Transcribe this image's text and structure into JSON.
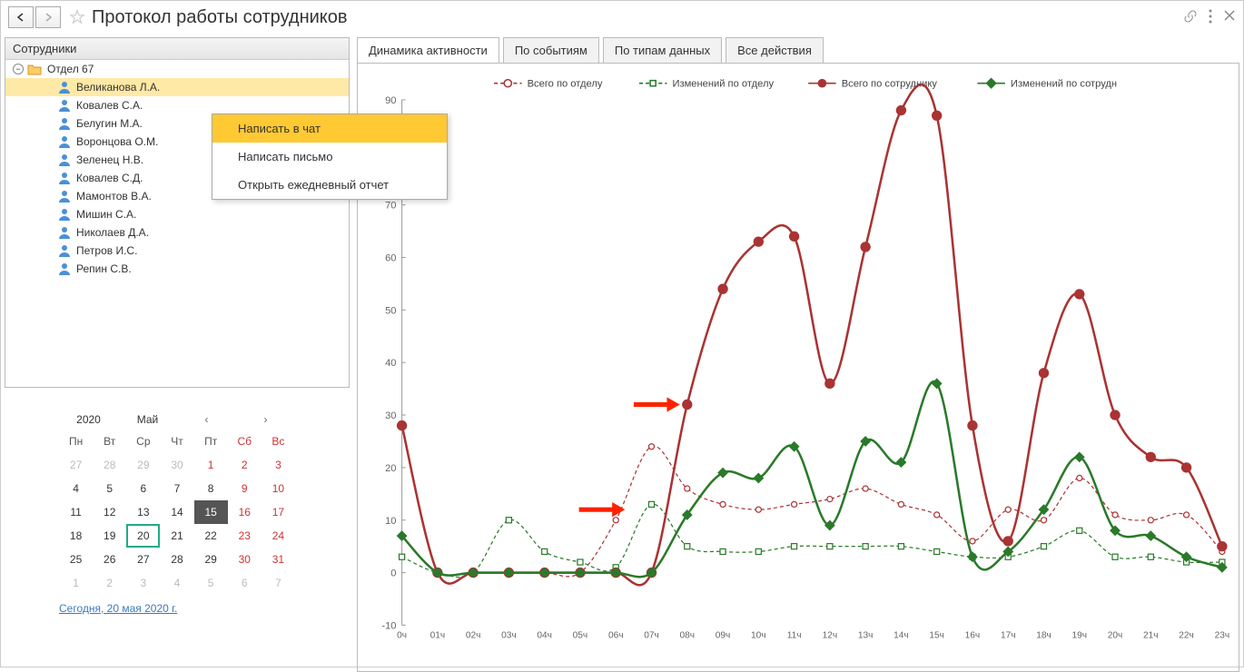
{
  "header": {
    "title": "Протокол работы сотрудников"
  },
  "sidebar": {
    "title": "Сотрудники",
    "dept": "Отдел 67",
    "employees": [
      "Великанова Л.А.",
      "Ковалев С.А.",
      "Белугин М.А.",
      "Воронцова О.М.",
      "Зеленец Н.В.",
      "Ковалев С.Д.",
      "Мамонтов В.А.",
      "Мишин С.А.",
      "Николаев Д.А.",
      "Петров И.С.",
      "Репин С.В."
    ]
  },
  "context_menu": {
    "items": [
      "Написать в чат",
      "Написать письмо",
      "Открыть ежедневный отчет"
    ]
  },
  "calendar": {
    "year": "2020",
    "month": "Май",
    "dow": [
      "Пн",
      "Вт",
      "Ср",
      "Чт",
      "Пт",
      "Сб",
      "Вс"
    ],
    "today_link": "Сегодня, 20 мая 2020 г."
  },
  "tabs": [
    "Динамика активности",
    "По событиям",
    "По типам данных",
    "Все действия"
  ],
  "legend": {
    "s1": "Всего по отделу",
    "s2": "Изменений по отделу",
    "s3": "Всего по сотруднику",
    "s4": "Изменений по сотрудн"
  },
  "chart_data": {
    "type": "line",
    "title": "",
    "xlabel": "",
    "ylabel": "",
    "ylim": [
      -10,
      90
    ],
    "categories": [
      "0ч",
      "01ч",
      "02ч",
      "03ч",
      "04ч",
      "05ч",
      "06ч",
      "07ч",
      "08ч",
      "09ч",
      "10ч",
      "11ч",
      "12ч",
      "13ч",
      "14ч",
      "15ч",
      "16ч",
      "17ч",
      "18ч",
      "19ч",
      "20ч",
      "21ч",
      "22ч",
      "23ч"
    ],
    "series": [
      {
        "name": "Всего по отделу",
        "values": [
          7,
          0,
          0,
          0,
          0,
          0,
          10,
          24,
          16,
          13,
          12,
          13,
          14,
          16,
          13,
          11,
          6,
          12,
          10,
          18,
          11,
          10,
          11,
          4
        ]
      },
      {
        "name": "Изменений по отделу",
        "values": [
          3,
          0,
          0,
          10,
          4,
          2,
          1,
          13,
          5,
          4,
          4,
          5,
          5,
          5,
          5,
          4,
          3,
          3,
          5,
          8,
          3,
          3,
          2,
          2
        ]
      },
      {
        "name": "Всего по сотруднику",
        "values": [
          28,
          0,
          0,
          0,
          0,
          0,
          0,
          0,
          32,
          54,
          63,
          64,
          36,
          62,
          88,
          87,
          28,
          6,
          38,
          53,
          30,
          22,
          20,
          5
        ]
      },
      {
        "name": "Изменений по сотрудн",
        "values": [
          7,
          0,
          0,
          0,
          0,
          0,
          0,
          0,
          11,
          19,
          18,
          24,
          9,
          25,
          21,
          36,
          3,
          4,
          12,
          22,
          8,
          7,
          3,
          1
        ]
      }
    ]
  }
}
